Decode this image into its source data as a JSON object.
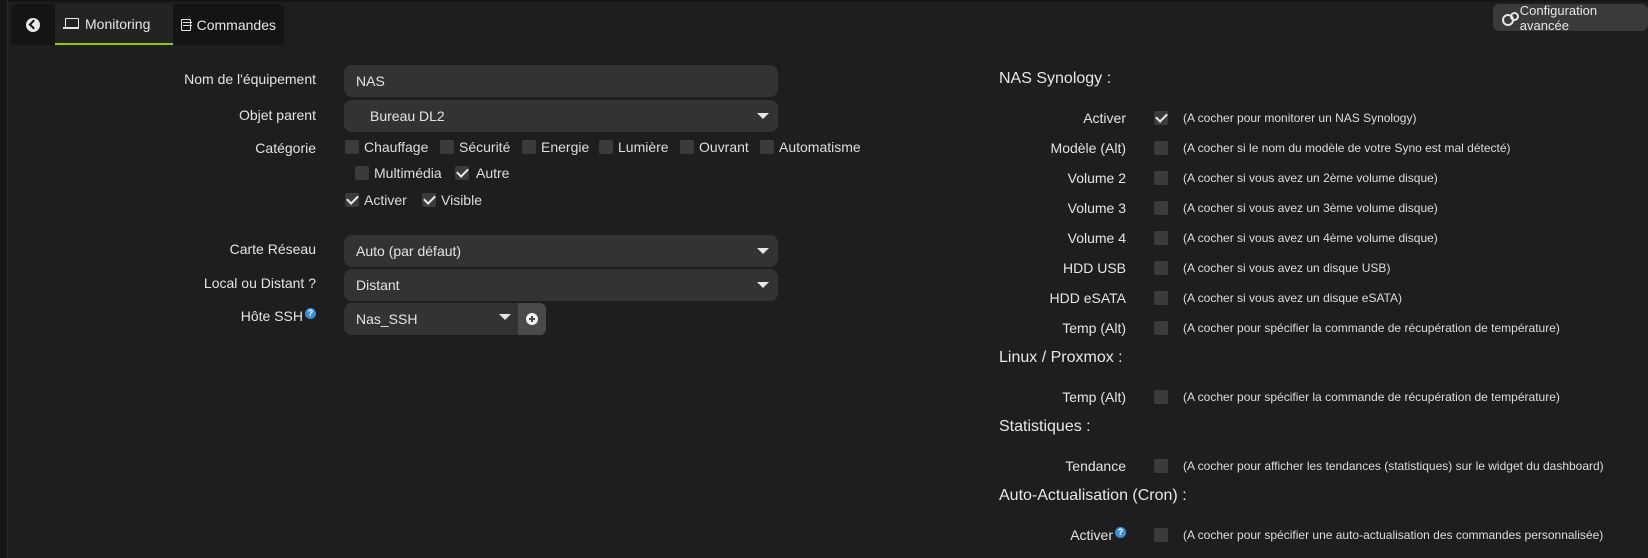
{
  "tabs": {
    "monitoring": "Monitoring",
    "commandes": "Commandes"
  },
  "advanced_button": "Configuration avancée",
  "form": {
    "name_label": "Nom de l'équipement",
    "name_value": "NAS",
    "parent_label": "Objet parent",
    "parent_value": "Bureau DL2",
    "category_label": "Catégorie",
    "categories": [
      {
        "label": "Chauffage",
        "checked": false
      },
      {
        "label": "Sécurité",
        "checked": false
      },
      {
        "label": "Energie",
        "checked": false
      },
      {
        "label": "Lumière",
        "checked": false
      },
      {
        "label": "Ouvrant",
        "checked": false
      },
      {
        "label": "Automatisme",
        "checked": false
      },
      {
        "label": "Multimédia",
        "checked": false
      },
      {
        "label": "Autre",
        "checked": true
      }
    ],
    "activate_label": "Activer",
    "visible_label": "Visible",
    "network_label": "Carte Réseau",
    "network_value": "Auto (par défaut)",
    "local_label": "Local ou Distant ?",
    "local_value": "Distant",
    "ssh_label": "Hôte SSH",
    "ssh_value": "Nas_SSH"
  },
  "right": {
    "nas_title": "NAS Synology :",
    "nas_rows": [
      {
        "label": "Activer",
        "checked": true,
        "desc": "(A cocher pour monitorer un NAS Synology)"
      },
      {
        "label": "Modèle (Alt)",
        "checked": false,
        "desc": "(A cocher si le nom du modèle de votre Syno est mal détecté)"
      },
      {
        "label": "Volume 2",
        "checked": false,
        "desc": "(A cocher si vous avez un 2ème volume disque)"
      },
      {
        "label": "Volume 3",
        "checked": false,
        "desc": "(A cocher si vous avez un 3ème volume disque)"
      },
      {
        "label": "Volume 4",
        "checked": false,
        "desc": "(A cocher si vous avez un 4ème volume disque)"
      },
      {
        "label": "HDD USB",
        "checked": false,
        "desc": "(A cocher si vous avez un disque USB)"
      },
      {
        "label": "HDD eSATA",
        "checked": false,
        "desc": "(A cocher si vous avez un disque eSATA)"
      },
      {
        "label": "Temp (Alt)",
        "checked": false,
        "desc": "(A cocher pour spécifier la commande de récupération de température)"
      }
    ],
    "linux_title": "Linux / Proxmox :",
    "linux_rows": [
      {
        "label": "Temp (Alt)",
        "checked": false,
        "desc": "(A cocher pour spécifier la commande de récupération de température)"
      }
    ],
    "stats_title": "Statistiques :",
    "stats_rows": [
      {
        "label": "Tendance",
        "checked": false,
        "desc": "(A cocher pour afficher les tendances (statistiques) sur le widget du dashboard)"
      }
    ],
    "cron_title": "Auto-Actualisation (Cron) :",
    "cron_rows": [
      {
        "label": "Activer",
        "checked": false,
        "desc": "(A cocher pour spécifier une auto-actualisation des commandes personnalisée)"
      }
    ]
  }
}
